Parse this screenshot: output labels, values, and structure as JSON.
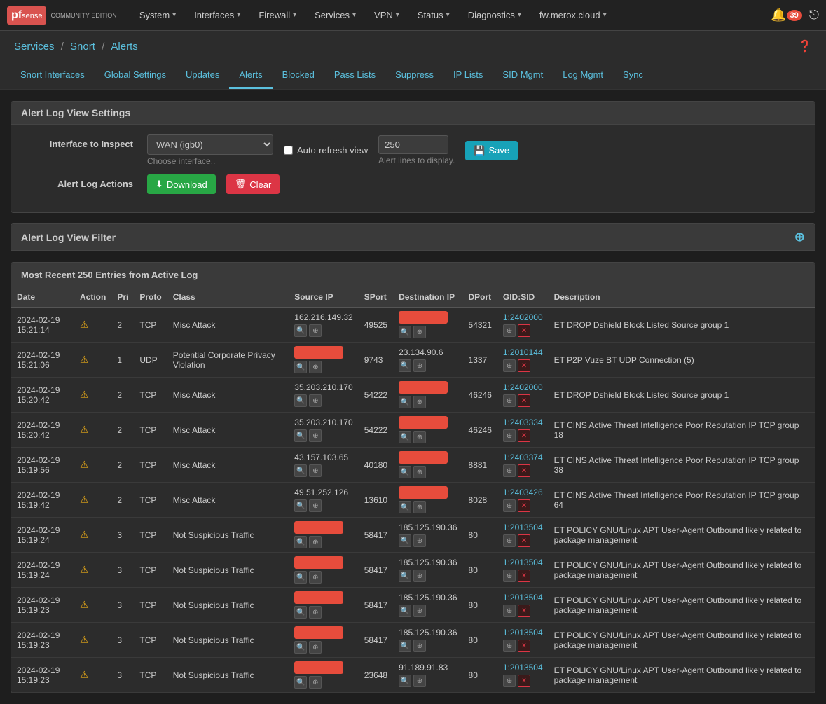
{
  "topnav": {
    "logo_pf": "pf",
    "logo_sense": "sense",
    "logo_edition": "COMMUNITY EDITION",
    "nav_items": [
      {
        "label": "System",
        "id": "system"
      },
      {
        "label": "Interfaces",
        "id": "interfaces"
      },
      {
        "label": "Firewall",
        "id": "firewall"
      },
      {
        "label": "Services",
        "id": "services"
      },
      {
        "label": "VPN",
        "id": "vpn"
      },
      {
        "label": "Status",
        "id": "status"
      },
      {
        "label": "Diagnostics",
        "id": "diagnostics"
      },
      {
        "label": "fw.merox.cloud",
        "id": "fw"
      }
    ],
    "bell_count": "39"
  },
  "breadcrumb": {
    "services": "Services",
    "snort": "Snort",
    "alerts": "Alerts",
    "sep": "/"
  },
  "tabs": [
    {
      "label": "Snort Interfaces",
      "id": "snort-interfaces",
      "active": false
    },
    {
      "label": "Global Settings",
      "id": "global-settings",
      "active": false
    },
    {
      "label": "Updates",
      "id": "updates",
      "active": false
    },
    {
      "label": "Alerts",
      "id": "alerts",
      "active": true
    },
    {
      "label": "Blocked",
      "id": "blocked",
      "active": false
    },
    {
      "label": "Pass Lists",
      "id": "pass-lists",
      "active": false
    },
    {
      "label": "Suppress",
      "id": "suppress",
      "active": false
    },
    {
      "label": "IP Lists",
      "id": "ip-lists",
      "active": false
    },
    {
      "label": "SID Mgmt",
      "id": "sid-mgmt",
      "active": false
    },
    {
      "label": "Log Mgmt",
      "id": "log-mgmt",
      "active": false
    },
    {
      "label": "Sync",
      "id": "sync",
      "active": false
    }
  ],
  "alert_log_view": {
    "title": "Alert Log View Settings",
    "interface_label": "Interface to Inspect",
    "interface_value": "WAN (igb0)",
    "interface_hint": "Choose interface..",
    "auto_refresh_label": "Auto-refresh view",
    "alert_lines_value": "250",
    "alert_lines_hint": "Alert lines to display.",
    "save_label": "Save"
  },
  "alert_log_actions": {
    "label": "Alert Log Actions",
    "download_label": "Download",
    "clear_label": "Clear"
  },
  "filter": {
    "title": "Alert Log View Filter"
  },
  "table": {
    "title": "Most Recent 250 Entries from Active Log",
    "columns": [
      "Date",
      "Action",
      "Pri",
      "Proto",
      "Class",
      "Source IP",
      "SPort",
      "Destination IP",
      "DPort",
      "GID:SID",
      "Description"
    ],
    "rows": [
      {
        "date": "2024-02-19\n15:21:14",
        "action": "warn",
        "pri": "2",
        "proto": "TCP",
        "class": "Misc Attack",
        "source_ip": "162.216.149.32",
        "source_redacted": false,
        "sport": "49525",
        "dest_ip_redacted": true,
        "dport": "54321",
        "gid_sid": "1:2402000",
        "description": "ET DROP Dshield Block Listed Source group 1"
      },
      {
        "date": "2024-02-19\n15:21:06",
        "action": "warn",
        "pri": "1",
        "proto": "UDP",
        "class": "Potential Corporate Privacy Violation",
        "source_ip": "redacted",
        "source_redacted": true,
        "sport": "9743",
        "dest_ip": "23.134.90.6",
        "dest_ip_redacted": false,
        "dport": "1337",
        "gid_sid": "1:2010144",
        "description": "ET P2P Vuze BT UDP Connection (5)"
      },
      {
        "date": "2024-02-19\n15:20:42",
        "action": "warn",
        "pri": "2",
        "proto": "TCP",
        "class": "Misc Attack",
        "source_ip": "35.203.210.170",
        "source_redacted": false,
        "sport": "54222",
        "dest_ip_redacted": true,
        "dport": "46246",
        "gid_sid": "1:2402000",
        "description": "ET DROP Dshield Block Listed Source group 1"
      },
      {
        "date": "2024-02-19\n15:20:42",
        "action": "warn",
        "pri": "2",
        "proto": "TCP",
        "class": "Misc Attack",
        "source_ip": "35.203.210.170",
        "source_redacted": false,
        "sport": "54222",
        "dest_ip_redacted": true,
        "dport": "46246",
        "gid_sid": "1:2403334",
        "description": "ET CINS Active Threat Intelligence Poor Reputation IP TCP group 18"
      },
      {
        "date": "2024-02-19\n15:19:56",
        "action": "warn",
        "pri": "2",
        "proto": "TCP",
        "class": "Misc Attack",
        "source_ip": "43.157.103.65",
        "source_redacted": false,
        "sport": "40180",
        "dest_ip_redacted": true,
        "dport": "8881",
        "gid_sid": "1:2403374",
        "description": "ET CINS Active Threat Intelligence Poor Reputation IP TCP group 38"
      },
      {
        "date": "2024-02-19\n15:19:42",
        "action": "warn",
        "pri": "2",
        "proto": "TCP",
        "class": "Misc Attack",
        "source_ip": "49.51.252.126",
        "source_redacted": false,
        "sport": "13610",
        "dest_ip_redacted": true,
        "dport": "8028",
        "gid_sid": "1:2403426",
        "description": "ET CINS Active Threat Intelligence Poor Reputation IP TCP group 64"
      },
      {
        "date": "2024-02-19\n15:19:24",
        "action": "warn",
        "pri": "3",
        "proto": "TCP",
        "class": "Not Suspicious Traffic",
        "source_ip_redacted": true,
        "sport": "58417",
        "dest_ip": "185.125.190.36",
        "dest_ip_redacted": false,
        "dport": "80",
        "gid_sid": "1:2013504",
        "description": "ET POLICY GNU/Linux APT User-Agent Outbound likely related to package management"
      },
      {
        "date": "2024-02-19\n15:19:24",
        "action": "warn",
        "pri": "3",
        "proto": "TCP",
        "class": "Not Suspicious Traffic",
        "source_ip_redacted": true,
        "sport": "58417",
        "dest_ip": "185.125.190.36",
        "dest_ip_redacted": false,
        "dport": "80",
        "gid_sid": "1:2013504",
        "description": "ET POLICY GNU/Linux APT User-Agent Outbound likely related to package management"
      },
      {
        "date": "2024-02-19\n15:19:23",
        "action": "warn",
        "pri": "3",
        "proto": "TCP",
        "class": "Not Suspicious Traffic",
        "source_ip_redacted": true,
        "sport": "58417",
        "dest_ip": "185.125.190.36",
        "dest_ip_redacted": false,
        "dport": "80",
        "gid_sid": "1:2013504",
        "description": "ET POLICY GNU/Linux APT User-Agent Outbound likely related to package management"
      },
      {
        "date": "2024-02-19\n15:19:23",
        "action": "warn",
        "pri": "3",
        "proto": "TCP",
        "class": "Not Suspicious Traffic",
        "source_ip_redacted": true,
        "sport": "58417",
        "dest_ip": "185.125.190.36",
        "dest_ip_redacted": false,
        "dport": "80",
        "gid_sid": "1:2013504",
        "description": "ET POLICY GNU/Linux APT User-Agent Outbound likely related to package management"
      },
      {
        "date": "2024-02-19\n15:19:23",
        "action": "warn",
        "pri": "3",
        "proto": "TCP",
        "class": "Not Suspicious Traffic",
        "source_ip_redacted": true,
        "sport": "23648",
        "dest_ip": "91.189.91.83",
        "dest_ip_redacted": false,
        "dport": "80",
        "gid_sid": "1:2013504",
        "description": "ET POLICY GNU/Linux APT User-Agent Outbound likely related to package management"
      }
    ]
  }
}
